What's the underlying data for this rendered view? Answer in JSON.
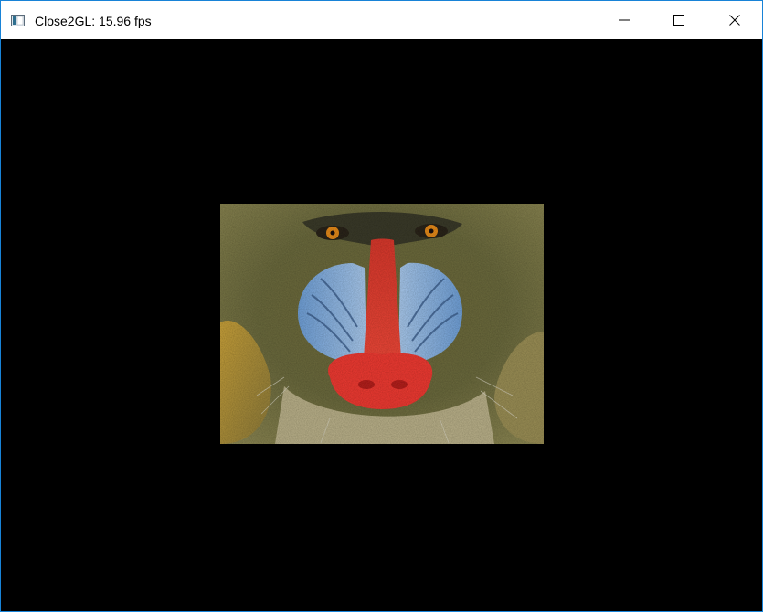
{
  "window": {
    "title": "Close2GL: 15.96 fps",
    "app_icon": "opengl-window-icon"
  },
  "caption_buttons": {
    "minimize_icon": "minimize-icon",
    "maximize_icon": "maximize-icon",
    "close_icon": "close-icon"
  },
  "viewport": {
    "background": "#000000",
    "texture": "mandrill-face-texture"
  },
  "colors": {
    "window_border": "#1883d7",
    "titlebar_bg": "#ffffff",
    "title_text": "#000000"
  }
}
